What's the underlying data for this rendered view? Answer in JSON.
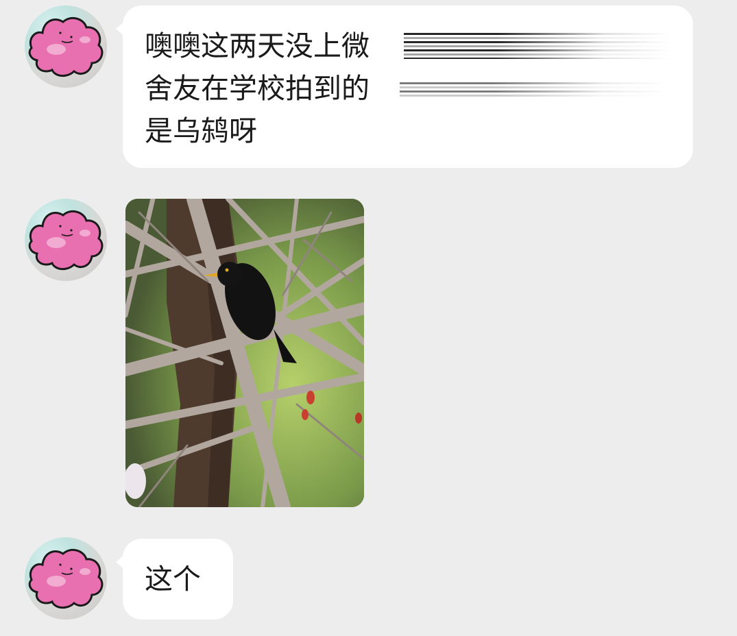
{
  "chat": {
    "messages": [
      {
        "type": "text",
        "lines": [
          "噢噢这两天没上微",
          "舍友在学校拍到的",
          "是乌鸫呀"
        ],
        "redacted_after_line": [
          true,
          true,
          false
        ]
      },
      {
        "type": "image",
        "image_description_icon": "photo-icon"
      },
      {
        "type": "text",
        "lines": [
          "这个"
        ]
      }
    ]
  },
  "colors": {
    "background": "#ededed",
    "bubble": "#ffffff",
    "text": "#1a1a1a",
    "avatar_pink": "#e86fb0"
  }
}
